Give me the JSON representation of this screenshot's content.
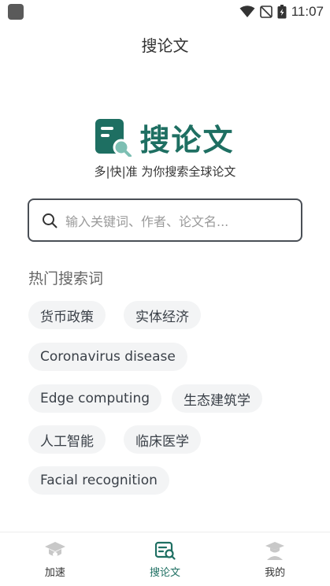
{
  "status_bar": {
    "time": "11:07"
  },
  "header": {
    "title": "搜论文"
  },
  "brand": {
    "name": "搜论文",
    "tagline": "多|快|准 为你搜索全球论文"
  },
  "search": {
    "placeholder": "输入关键词、作者、论文名..."
  },
  "hot": {
    "title": "热门搜索词",
    "tags": [
      "货币政策",
      "实体经济",
      "Coronavirus disease",
      "Edge computing",
      "生态建筑学",
      "人工智能",
      "临床医学",
      "Facial recognition"
    ]
  },
  "nav": {
    "items": [
      {
        "label": "加速",
        "icon": "mortarboard-gear-icon"
      },
      {
        "label": "搜论文",
        "icon": "paper-search-icon"
      },
      {
        "label": "我的",
        "icon": "graduate-user-icon"
      }
    ],
    "active_index": 1
  },
  "colors": {
    "brand": "#1e6f62",
    "tag_bg": "#f3f4f5",
    "inactive_icon": "#c8c8c8"
  }
}
